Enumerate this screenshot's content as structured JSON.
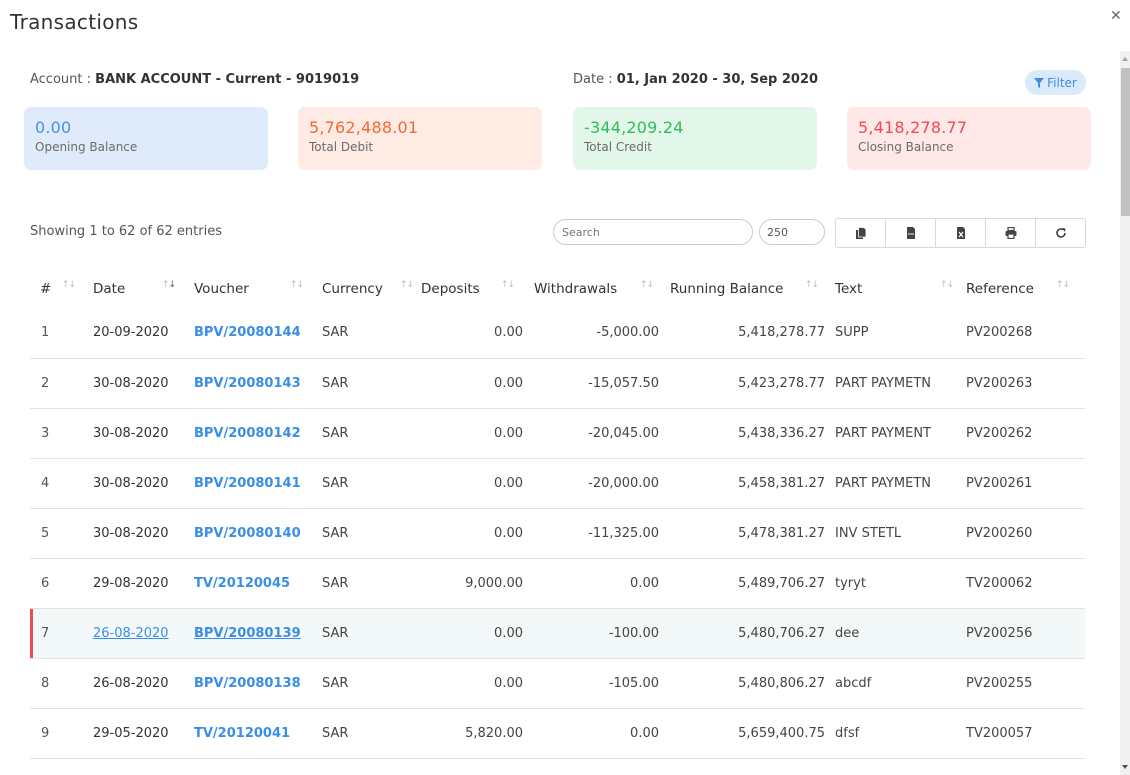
{
  "modal": {
    "title": "Transactions",
    "close_icon": "close-icon"
  },
  "meta": {
    "account_label": "Account :",
    "account_value": "BANK ACCOUNT - Current - 9019019",
    "date_label": "Date :",
    "date_value": "01, Jan 2020 - 30, Sep 2020",
    "filter_label": "Filter"
  },
  "cards": [
    {
      "value": "0.00",
      "label": "Opening Balance",
      "color": "#4a90e2"
    },
    {
      "value": "5,762,488.01",
      "label": "Total Debit",
      "color": "#f26a32"
    },
    {
      "value": "-344,209.24",
      "label": "Total Credit",
      "color": "#2fbd5b"
    },
    {
      "value": "5,418,278.77",
      "label": "Closing Balance",
      "color": "#f04a55"
    }
  ],
  "toolbar": {
    "showing": "Showing 1 to 62 of 62 entries",
    "search_placeholder": "Search",
    "page_size": "250",
    "buttons": [
      "copy-icon",
      "csv-icon",
      "excel-icon",
      "print-icon",
      "refresh-icon"
    ]
  },
  "table": {
    "columns": [
      "#",
      "Date",
      "Voucher",
      "Currency",
      "Deposits",
      "Withdrawals",
      "Running Balance",
      "Text",
      "Reference"
    ],
    "rows": [
      {
        "idx": "1",
        "date": "20-09-2020",
        "voucher": "BPV/20080144",
        "currency": "SAR",
        "deposits": "0.00",
        "withdrawals": "-5,000.00",
        "balance": "5,418,278.77",
        "text": "SUPP",
        "reference": "PV200268"
      },
      {
        "idx": "2",
        "date": "30-08-2020",
        "voucher": "BPV/20080143",
        "currency": "SAR",
        "deposits": "0.00",
        "withdrawals": "-15,057.50",
        "balance": "5,423,278.77",
        "text": "PART PAYMETN",
        "reference": "PV200263"
      },
      {
        "idx": "3",
        "date": "30-08-2020",
        "voucher": "BPV/20080142",
        "currency": "SAR",
        "deposits": "0.00",
        "withdrawals": "-20,045.00",
        "balance": "5,438,336.27",
        "text": "PART PAYMENT",
        "reference": "PV200262"
      },
      {
        "idx": "4",
        "date": "30-08-2020",
        "voucher": "BPV/20080141",
        "currency": "SAR",
        "deposits": "0.00",
        "withdrawals": "-20,000.00",
        "balance": "5,458,381.27",
        "text": "PART PAYMETN",
        "reference": "PV200261"
      },
      {
        "idx": "5",
        "date": "30-08-2020",
        "voucher": "BPV/20080140",
        "currency": "SAR",
        "deposits": "0.00",
        "withdrawals": "-11,325.00",
        "balance": "5,478,381.27",
        "text": "INV STETL",
        "reference": "PV200260"
      },
      {
        "idx": "6",
        "date": "29-08-2020",
        "voucher": "TV/20120045",
        "currency": "SAR",
        "deposits": "9,000.00",
        "withdrawals": "0.00",
        "balance": "5,489,706.27",
        "text": "tyryt",
        "reference": "TV200062"
      },
      {
        "idx": "7",
        "date": "26-08-2020",
        "voucher": "BPV/20080139",
        "currency": "SAR",
        "deposits": "0.00",
        "withdrawals": "-100.00",
        "balance": "5,480,706.27",
        "text": "dee",
        "reference": "PV200256",
        "highlighted": true
      },
      {
        "idx": "8",
        "date": "26-08-2020",
        "voucher": "BPV/20080138",
        "currency": "SAR",
        "deposits": "0.00",
        "withdrawals": "-105.00",
        "balance": "5,480,806.27",
        "text": "abcdf",
        "reference": "PV200255"
      },
      {
        "idx": "9",
        "date": "29-05-2020",
        "voucher": "TV/20120041",
        "currency": "SAR",
        "deposits": "5,820.00",
        "withdrawals": "0.00",
        "balance": "5,659,400.75",
        "text": "dfsf",
        "reference": "TV200057"
      }
    ]
  }
}
